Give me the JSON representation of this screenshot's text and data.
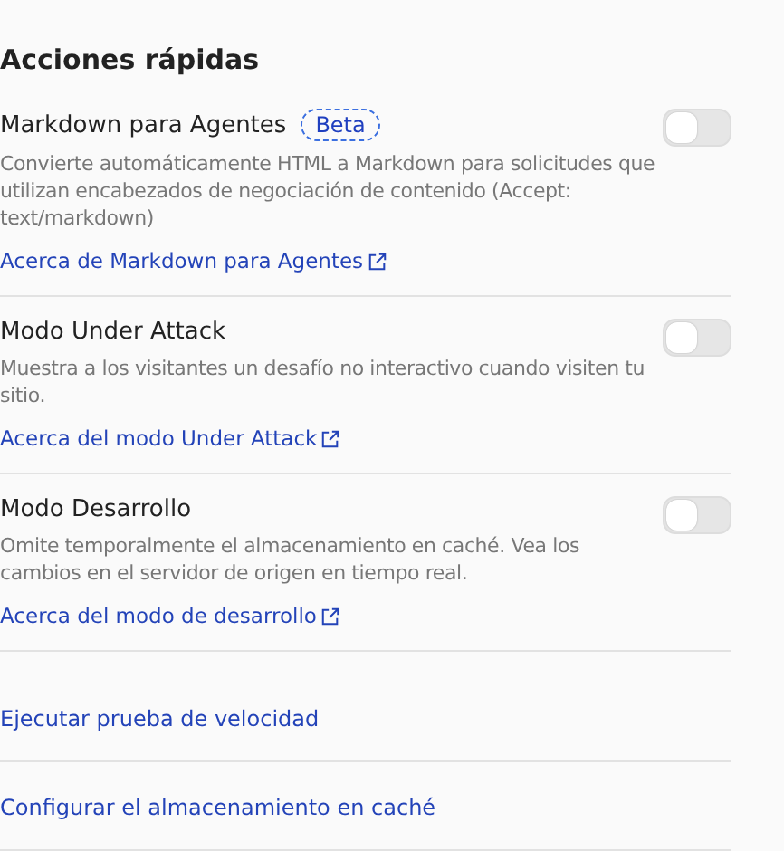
{
  "section_title": "Acciones rápidas",
  "settings": [
    {
      "title": "Markdown para Agentes",
      "badge": "Beta",
      "description": "Convierte automáticamente HTML a Markdown para solicitudes que utilizan encabezados de negociación de contenido (Accept: text/markdown)",
      "link": "Acerca de Markdown para Agentes",
      "on": false
    },
    {
      "title": "Modo Under Attack",
      "description": "Muestra a los visitantes un desafío no interactivo cuando visiten tu sitio.",
      "link": "Acerca del modo Under Attack",
      "on": false
    },
    {
      "title": "Modo Desarrollo",
      "description": "Omite temporalmente el almacenamiento en caché. Vea los cambios en el servidor de origen en tiempo real.",
      "link": "Acerca del modo de desarrollo",
      "on": false
    }
  ],
  "actions": [
    "Ejecutar prueba de velocidad",
    "Configurar el almacenamiento en caché"
  ]
}
